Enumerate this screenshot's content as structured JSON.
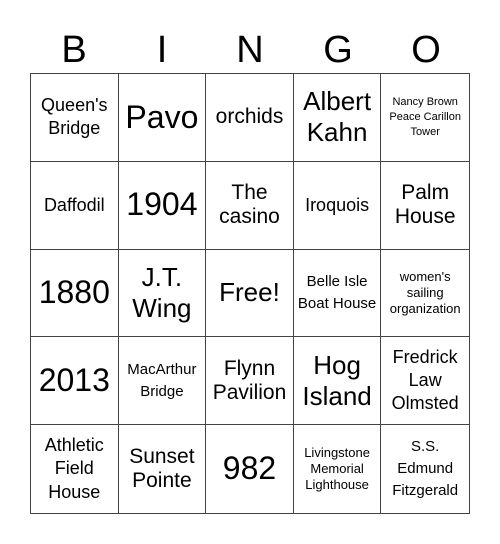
{
  "header": [
    "B",
    "I",
    "N",
    "G",
    "O"
  ],
  "cells": [
    {
      "text": "Queen's Bridge",
      "size": "s-n"
    },
    {
      "text": "Pavo",
      "size": "s-xl"
    },
    {
      "text": "orchids",
      "size": "s-m"
    },
    {
      "text": "Albert Kahn",
      "size": "s-l"
    },
    {
      "text": "Nancy Brown Peace Carillon Tower",
      "size": "s-xxs"
    },
    {
      "text": "Daffodil",
      "size": "s-n"
    },
    {
      "text": "1904",
      "size": "s-xl"
    },
    {
      "text": "The casino",
      "size": "s-m"
    },
    {
      "text": "Iroquois",
      "size": "s-n"
    },
    {
      "text": "Palm House",
      "size": "s-m"
    },
    {
      "text": "1880",
      "size": "s-xl"
    },
    {
      "text": "J.T. Wing",
      "size": "s-l"
    },
    {
      "text": "Free!",
      "size": "s-l"
    },
    {
      "text": "Belle Isle Boat House",
      "size": "s-s"
    },
    {
      "text": "women's sailing organization",
      "size": "s-xs"
    },
    {
      "text": "2013",
      "size": "s-xl"
    },
    {
      "text": "MacArthur Bridge",
      "size": "s-s"
    },
    {
      "text": "Flynn Pavilion",
      "size": "s-m"
    },
    {
      "text": "Hog Island",
      "size": "s-l"
    },
    {
      "text": "Fredrick Law Olmsted",
      "size": "s-n"
    },
    {
      "text": "Athletic Field House",
      "size": "s-n"
    },
    {
      "text": "Sunset Pointe",
      "size": "s-m"
    },
    {
      "text": "982",
      "size": "s-xl"
    },
    {
      "text": "Livingstone Memorial Lighthouse",
      "size": "s-xs"
    },
    {
      "text": "S.S. Edmund Fitzgerald",
      "size": "s-s"
    }
  ]
}
